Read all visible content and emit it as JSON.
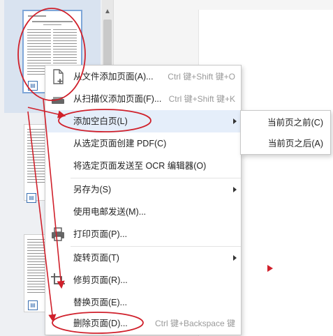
{
  "menu": {
    "items": [
      {
        "label": "从文件添加页面(A)...",
        "shortcut": "Ctrl 键+Shift 键+O"
      },
      {
        "label": "从扫描仪添加页面(F)...",
        "shortcut": "Ctrl 键+Shift 键+K"
      },
      {
        "label": "添加空白页(L)",
        "shortcut": ""
      },
      {
        "label": "从选定页面创建 PDF(C)",
        "shortcut": ""
      },
      {
        "label": "将选定页面发送至 OCR 编辑器(O)",
        "shortcut": ""
      },
      {
        "label": "另存为(S)",
        "shortcut": ""
      },
      {
        "label": "使用电邮发送(M)...",
        "shortcut": ""
      },
      {
        "label": "打印页面(P)...",
        "shortcut": ""
      },
      {
        "label": "旋转页面(T)",
        "shortcut": ""
      },
      {
        "label": "修剪页面(R)...",
        "shortcut": ""
      },
      {
        "label": "替换页面(E)...",
        "shortcut": ""
      },
      {
        "label": "删除页面(D)...",
        "shortcut": "Ctrl 键+Backspace 键"
      }
    ]
  },
  "submenu": {
    "items": [
      {
        "label": "当前页之前(C)"
      },
      {
        "label": "当前页之后(A)"
      }
    ]
  },
  "colors": {
    "annotation": "#d0202b",
    "highlight": "#e5eefa",
    "selection": "#d9e3f0"
  }
}
